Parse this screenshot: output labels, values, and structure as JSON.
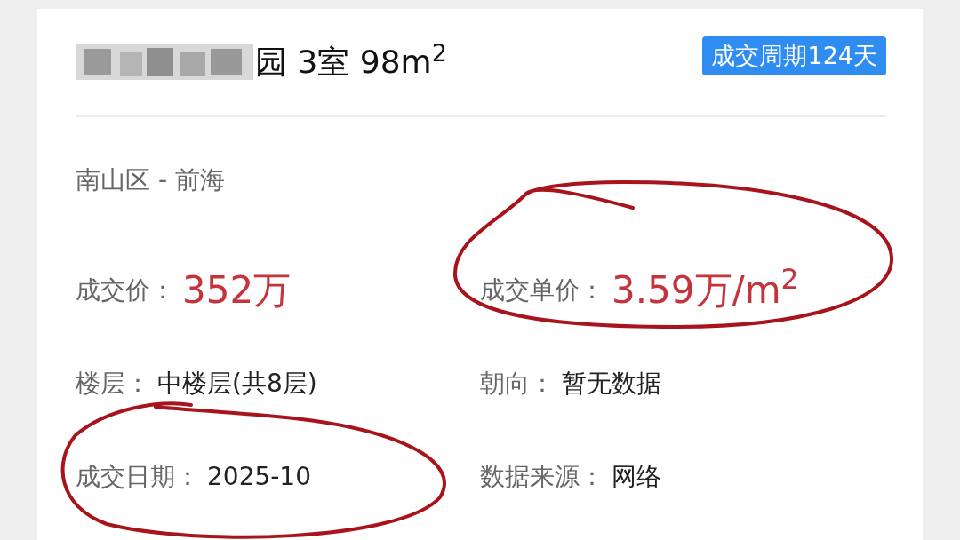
{
  "title": "园 3室 98m$^{2}$",
  "badge": "成交周期124天",
  "district": "南山区 - 前海",
  "fields": [
    {
      "label": "成交价：",
      "value": "352万",
      "kind": "price"
    },
    {
      "label": "成交单价：",
      "value": "3.59万/m$^{2}$",
      "kind": "price"
    },
    {
      "label": "楼层：",
      "value": "中楼层(共8层)",
      "kind": "plain"
    },
    {
      "label": "朝向：",
      "value": "暂无数据",
      "kind": "plain"
    },
    {
      "label": "成交日期：",
      "value": "2025-10",
      "kind": "plain"
    },
    {
      "label": "数据来源：",
      "value": "网络",
      "kind": "plain"
    }
  ]
}
